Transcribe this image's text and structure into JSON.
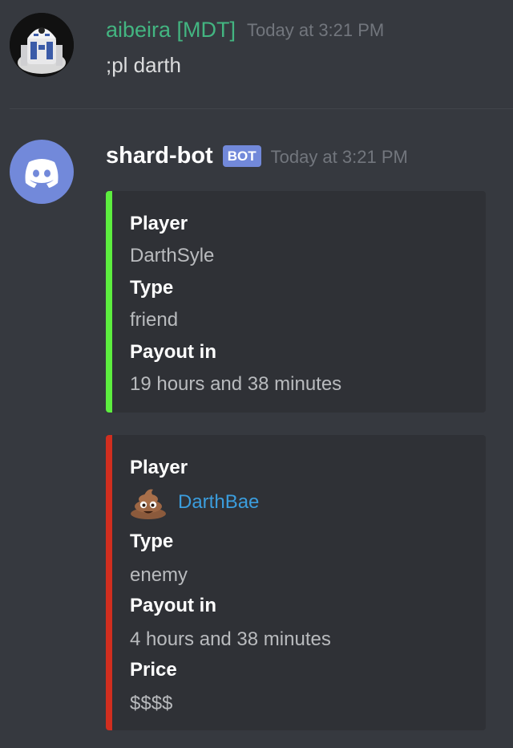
{
  "message1": {
    "username": "aibeira [MDT]",
    "timestamp": "Today at 3:21 PM",
    "text": ";pl darth",
    "username_color": "#43b581"
  },
  "message2": {
    "username": "shard-bot",
    "badge": "BOT",
    "timestamp": "Today at 3:21 PM",
    "badge_color": "#7289da",
    "embeds": [
      {
        "accent_color": "#5dee3f",
        "fields": [
          {
            "name": "Player",
            "value": "DarthSyle"
          },
          {
            "name": "Type",
            "value": "friend"
          },
          {
            "name": "Payout in",
            "value": "19 hours and 38 minutes"
          }
        ]
      },
      {
        "accent_color": "#d12e1f",
        "fields": [
          {
            "name": "Player",
            "value": "DarthBae",
            "icon": "poop-emoji-icon",
            "link": true
          },
          {
            "name": "Type",
            "value": "enemy"
          },
          {
            "name": "Payout in",
            "value": "4 hours and 38 minutes"
          },
          {
            "name": "Price",
            "value": "$$$$"
          }
        ]
      }
    ]
  }
}
